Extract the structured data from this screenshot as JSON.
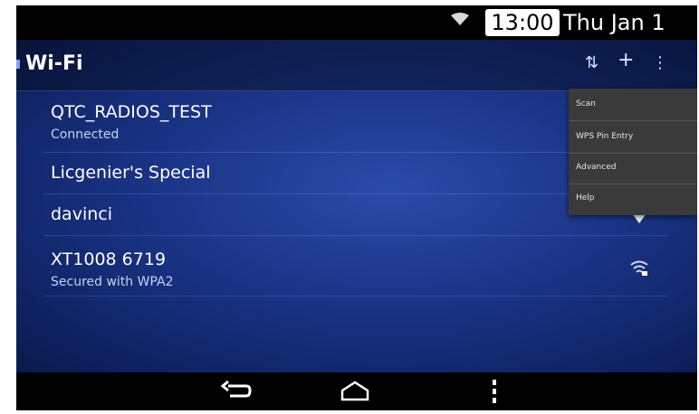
{
  "status_bar": {
    "time": "13:00",
    "date": "Thu Jan 1",
    "wifi_icon": "wifi-full-icon"
  },
  "action_bar": {
    "title": "Wi-Fi",
    "icons": [
      "wps-push-icon",
      "add-network-icon",
      "overflow-menu-icon"
    ]
  },
  "networks": [
    {
      "name": "QTC_RADIOS_TEST",
      "status": "Connected"
    },
    {
      "name": "Licgenier's Special",
      "status": ""
    },
    {
      "name": "davinci",
      "status": ""
    },
    {
      "name": "XT1008 6719",
      "status": "Secured with WPA2"
    }
  ],
  "overflow_menu": {
    "items": [
      "Scan",
      "WPS Pin Entry",
      "Advanced",
      "Help"
    ]
  },
  "nav_bar": {
    "icons": [
      "back-icon",
      "home-icon",
      "menu-icon"
    ]
  },
  "colors": {
    "background": "#1a3486",
    "menu": "#3a3a3a",
    "text": "#ffffff"
  }
}
